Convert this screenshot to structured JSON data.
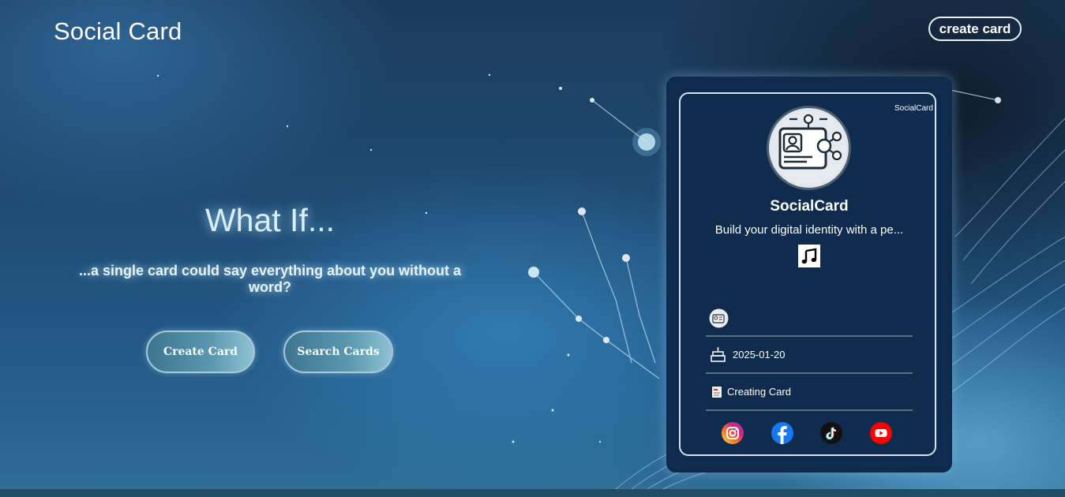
{
  "header": {
    "logo": "Social Card",
    "create_label": "create card"
  },
  "hero": {
    "title": "What If...",
    "subtitle": "...a single card could say everything about you without a word?",
    "buttons": [
      {
        "label": "Create Card"
      },
      {
        "label": "Search Cards"
      }
    ]
  },
  "card": {
    "brand": "SocialCard",
    "name": "SocialCard",
    "bio": "Build your digital identity with a pe...",
    "birthday": "2025-01-20",
    "status": "Creating Card",
    "icons": {
      "avatar": "id-card-network-icon",
      "music": "music-note-icon",
      "badge": "card-thumbnail-icon",
      "birthday": "cake-icon",
      "status": "note-icon"
    },
    "socials": [
      {
        "name": "instagram-icon",
        "color": "#e1306c"
      },
      {
        "name": "facebook-icon",
        "color": "#1877f2"
      },
      {
        "name": "tiktok-icon",
        "color": "#000000"
      },
      {
        "name": "youtube-icon",
        "color": "#ff0000"
      }
    ]
  },
  "colors": {
    "card_bg": "#0e2a4d",
    "button_start": "#3d7590",
    "button_end": "#8fc2d2"
  }
}
